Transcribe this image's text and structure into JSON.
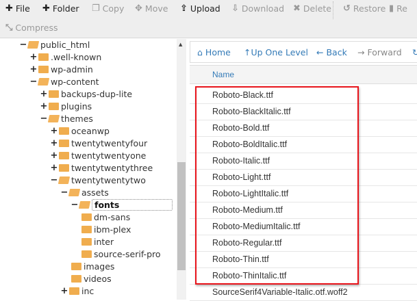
{
  "toolbar": {
    "items": [
      {
        "label": "File",
        "icon": "plus-icon",
        "enabled": true
      },
      {
        "label": "Folder",
        "icon": "plus-icon",
        "enabled": true
      },
      {
        "label": "Copy",
        "icon": "copy-icon",
        "enabled": false
      },
      {
        "label": "Move",
        "icon": "move-icon",
        "enabled": false
      },
      {
        "label": "Upload",
        "icon": "upload-icon",
        "enabled": true
      },
      {
        "label": "Download",
        "icon": "download-icon",
        "enabled": false
      },
      {
        "label": "Delete",
        "icon": "times-icon",
        "enabled": false
      },
      {
        "label": "Restore",
        "icon": "undo-icon",
        "enabled": false
      },
      {
        "label": "Re",
        "icon": "file-icon",
        "enabled": false
      },
      {
        "label": "Compress",
        "icon": "compress-icon",
        "enabled": false
      }
    ]
  },
  "tree": [
    {
      "label": "public_html",
      "toggle": "−",
      "open": true
    },
    {
      "label": ".well-known",
      "toggle": "+"
    },
    {
      "label": "wp-admin",
      "toggle": "+"
    },
    {
      "label": "wp-content",
      "toggle": "−",
      "open": true
    },
    {
      "label": "backups-dup-lite",
      "toggle": "+"
    },
    {
      "label": "plugins",
      "toggle": "+"
    },
    {
      "label": "themes",
      "toggle": "−",
      "open": true
    },
    {
      "label": "oceanwp",
      "toggle": "+"
    },
    {
      "label": "twentytwentyfour",
      "toggle": "+"
    },
    {
      "label": "twentytwentyone",
      "toggle": "+"
    },
    {
      "label": "twentytwentythree",
      "toggle": "+"
    },
    {
      "label": "twentytwentytwo",
      "toggle": "−",
      "open": true
    },
    {
      "label": "assets",
      "toggle": "−",
      "open": true
    },
    {
      "label": "fonts",
      "toggle": "−",
      "open": true,
      "selected": true
    },
    {
      "label": "dm-sans",
      "toggle": ""
    },
    {
      "label": "ibm-plex",
      "toggle": ""
    },
    {
      "label": "inter",
      "toggle": ""
    },
    {
      "label": "source-serif-pro",
      "toggle": ""
    },
    {
      "label": "images",
      "toggle": ""
    },
    {
      "label": "videos",
      "toggle": ""
    },
    {
      "label": "inc",
      "toggle": "+"
    }
  ],
  "nav": {
    "home": "Home",
    "up": "Up One Level",
    "back": "Back",
    "forward": "Forward"
  },
  "table": {
    "header": "Name",
    "rows": [
      "Roboto-Black.ttf",
      "Roboto-BlackItalic.ttf",
      "Roboto-Bold.ttf",
      "Roboto-BoldItalic.ttf",
      "Roboto-Italic.ttf",
      "Roboto-Light.ttf",
      "Roboto-LightItalic.ttf",
      "Roboto-Medium.ttf",
      "Roboto-MediumItalic.ttf",
      "Roboto-Regular.ttf",
      "Roboto-Thin.ttf",
      "Roboto-ThinItalic.ttf",
      "SourceSerif4Variable-Italic.otf.woff2"
    ]
  },
  "colors": {
    "accent": "#337ab7",
    "folder": "#f0ad4e",
    "highlight": "#e8141b"
  }
}
